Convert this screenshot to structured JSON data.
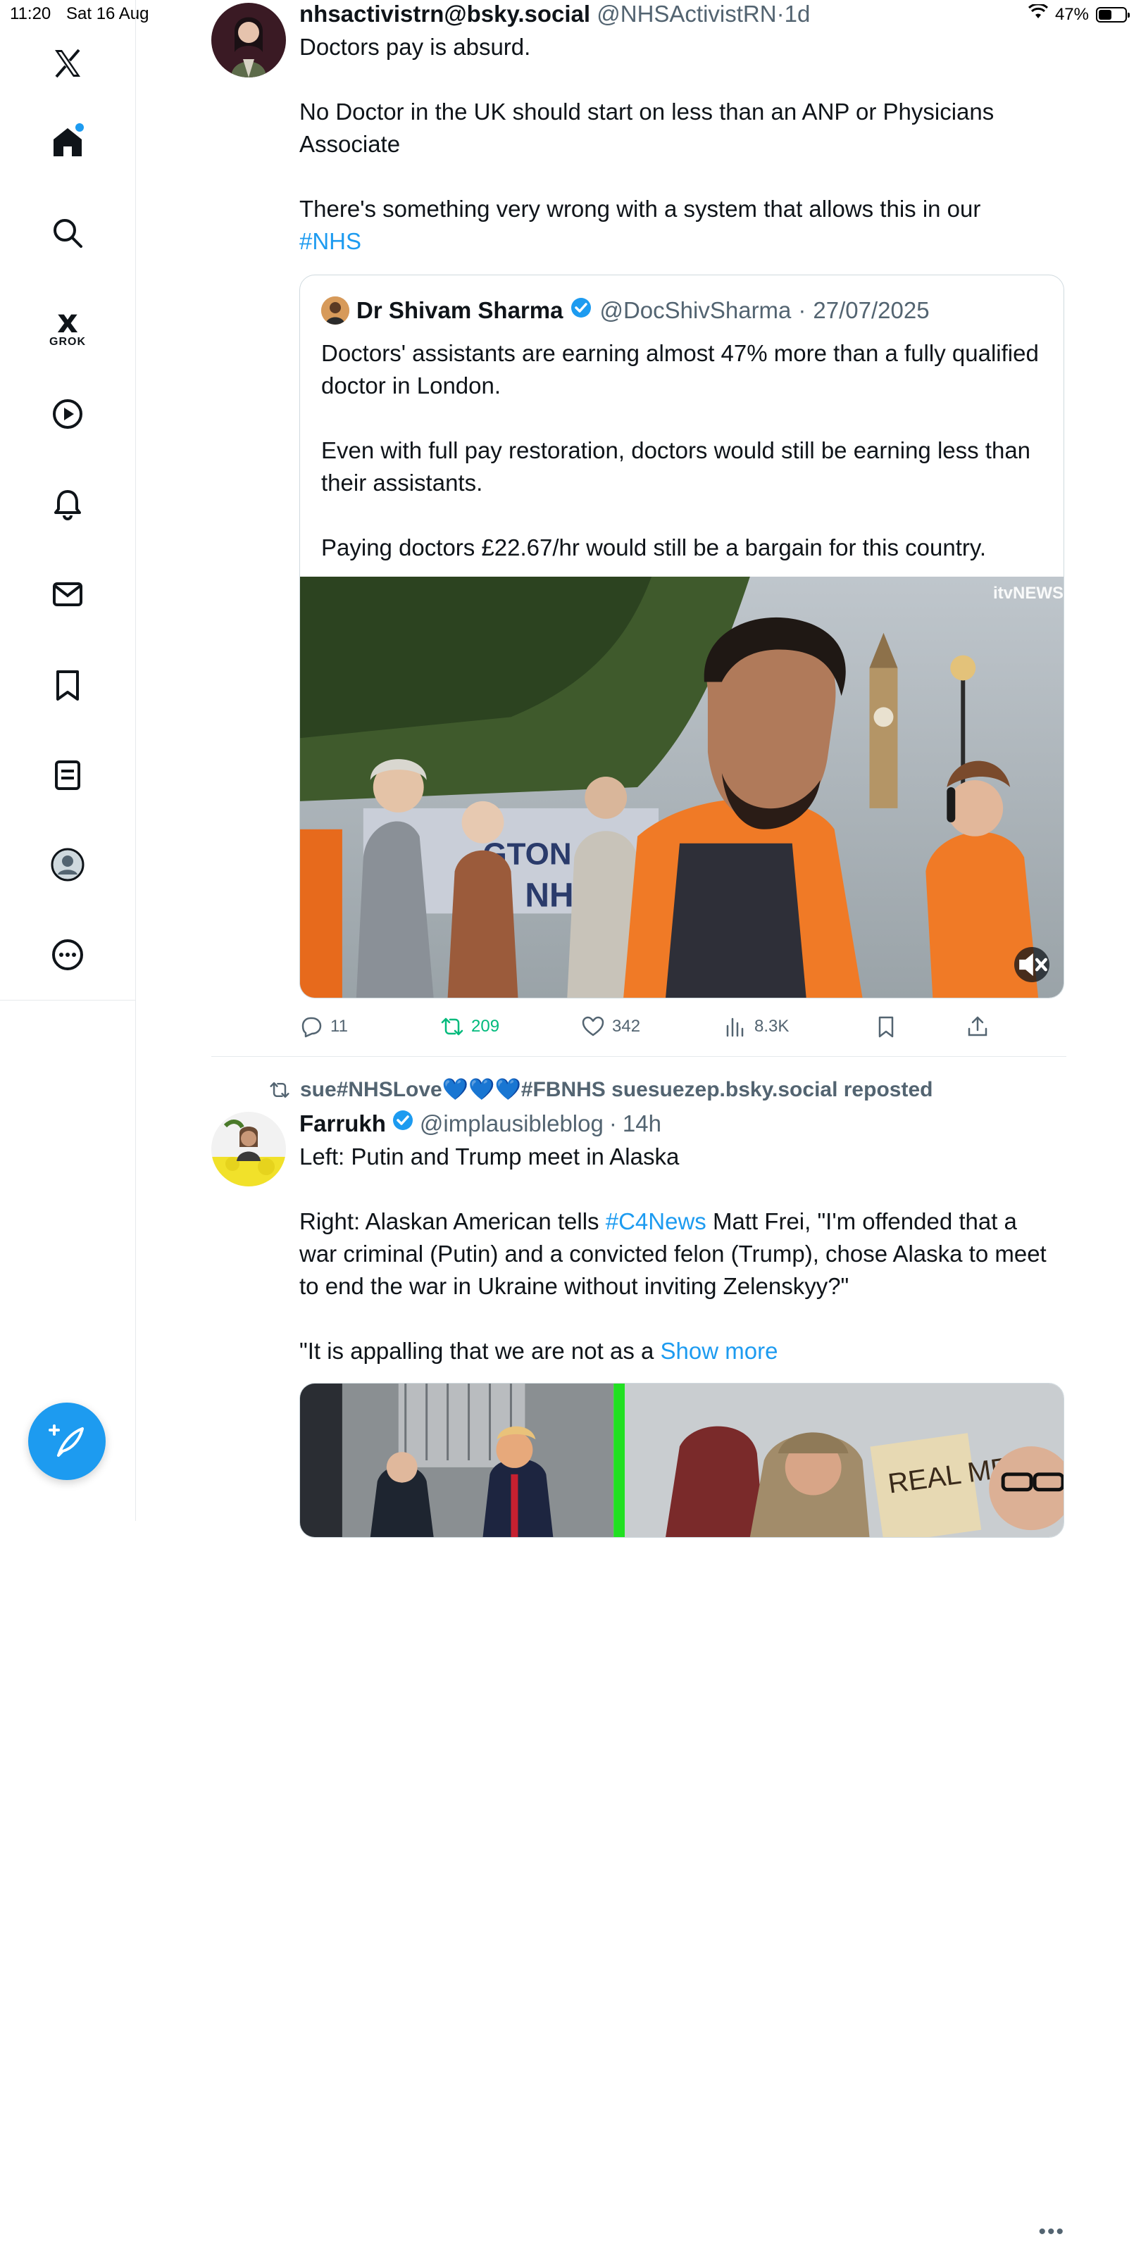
{
  "status_bar": {
    "time": "11:20",
    "date": "Sat 16 Aug",
    "battery": "47%"
  },
  "sidebar": {
    "grok_label": "GROK",
    "items": [
      "x-logo",
      "home-icon",
      "search-icon",
      "grok-icon",
      "video-icon",
      "notifications-icon",
      "messages-icon",
      "bookmarks-icon",
      "lists-icon",
      "profile-icon",
      "more-icon"
    ]
  },
  "tweet1": {
    "display_name": "nhsactivistrn@bsky.social",
    "handle": "@NHSActivistRN",
    "separator": "·",
    "time": "1d",
    "text_1": "Doctors pay is absurd.",
    "text_2": "No Doctor in the UK should start on less than an ANP or Physicians Associate",
    "text_3": "There's something very wrong with a system that allows this in our",
    "hashtag": "#NHS",
    "quote": {
      "display_name": "Dr Shivam Sharma",
      "handle": "@DocShivSharma",
      "separator": "·",
      "date": "27/07/2025",
      "text_1": "Doctors' assistants are earning almost 47% more than a fully qualified doctor in London.",
      "text_2": "Even with full pay restoration, doctors would still be earning less than their assistants.",
      "text_3": "Paying doctors £22.67/hr would still be a bargain for this country.",
      "video_watermark": "itvNEWS"
    },
    "stats": {
      "replies": "11",
      "reposts": "209",
      "likes": "342",
      "views": "8.3K"
    }
  },
  "tweet2": {
    "reposted_by": "sue#NHSLove💙💙💙#FBNHS suesuezep.bsky.social reposted",
    "display_name": "Farrukh",
    "handle": "@implausibleblog",
    "separator": "·",
    "time": "14h",
    "text_1": "Left: Putin and Trump meet in Alaska",
    "text_2a": "Right: Alaskan American tells ",
    "hashtag": "#C4News",
    "text_2b": " Matt Frei, \"I'm offended that a war criminal (Putin) and a convicted felon (Trump), chose Alaska to meet to end the war in Ukraine without inviting Zelenskyy?\"",
    "text_3": "\"It is appalling that we are not as a ",
    "show_more": "Show more",
    "sign_text": "REAL MEN"
  },
  "colors": {
    "accent": "#1d9bf0",
    "repost_green": "#00ba7c",
    "muted_text": "#536471",
    "border": "#cfd9de"
  }
}
